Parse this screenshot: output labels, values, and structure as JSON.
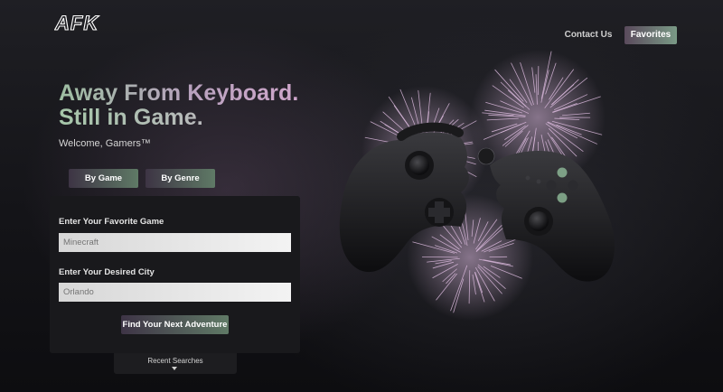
{
  "header": {
    "logo_text": "AFK",
    "nav": {
      "contact_label": "Contact Us",
      "favorites_label": "Favorites"
    }
  },
  "hero": {
    "headline_line1": "Away From Keyboard.",
    "headline_line2": "Still in Game.",
    "welcome": "Welcome, Gamers™"
  },
  "search_tabs": {
    "by_game": "By Game",
    "by_genre": "By Genre"
  },
  "search_form": {
    "game_label": "Enter Your Favorite Game",
    "game_placeholder": "Minecraft",
    "city_label": "Enter Your Desired City",
    "city_placeholder": "Orlando",
    "submit_label": "Find Your Next Adventure"
  },
  "recent_searches": {
    "label": "Recent Searches"
  },
  "colors": {
    "accent_start": "#5a4a5c",
    "accent_end": "#7a9a86",
    "firework": "#d9b8dc",
    "background": "#141418"
  },
  "icons": [
    "afk-logo",
    "game-controller-illustration",
    "fireworks-illustration",
    "chevron-down-icon"
  ]
}
